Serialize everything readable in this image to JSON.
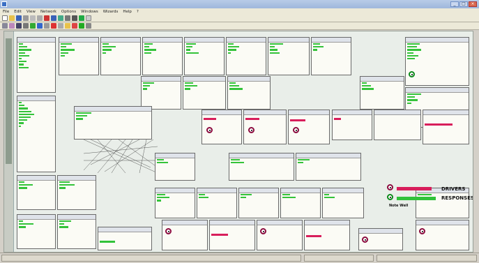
{
  "window": {
    "title": "",
    "controls": [
      "minimize",
      "maximize",
      "close"
    ]
  },
  "menu": [
    "File",
    "Edit",
    "View",
    "Network",
    "Options",
    "Windows",
    "Wizards",
    "Help",
    "?"
  ],
  "colors": {
    "drivers": "#d81e5b",
    "responses": "#31c23a",
    "driver_marker": "#8b0a3e",
    "response_marker": "#0b8a1a"
  },
  "legend": {
    "drivers": "DRIVERS",
    "responses": "RESPONSES",
    "note": "Note Well"
  }
}
